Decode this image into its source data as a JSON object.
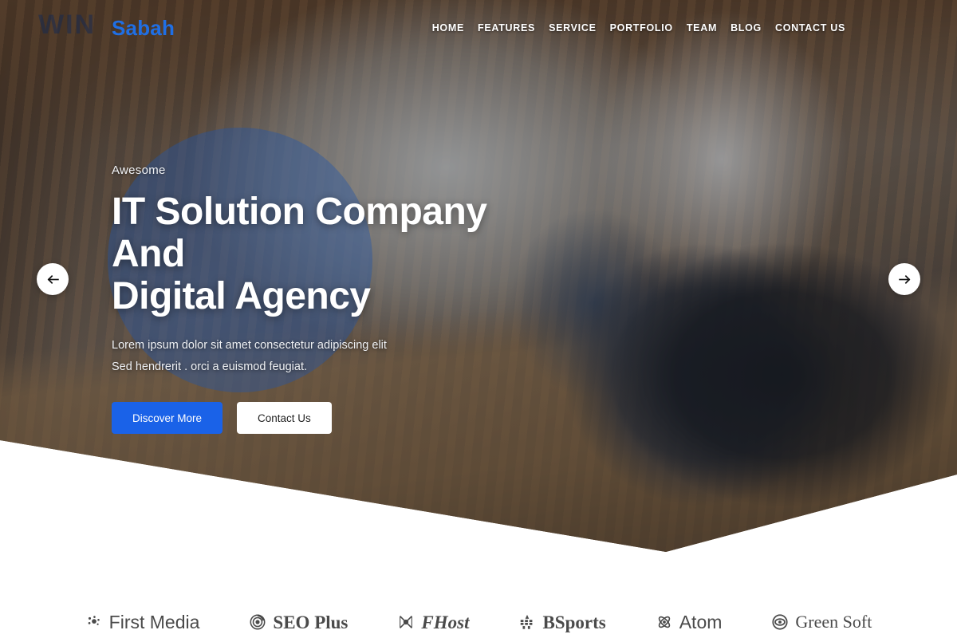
{
  "header": {
    "logo": "Sabah",
    "nav": [
      {
        "label": "HOME"
      },
      {
        "label": "FEATURES"
      },
      {
        "label": "SERVICE"
      },
      {
        "label": "PORTFOLIO"
      },
      {
        "label": "TEAM"
      },
      {
        "label": "BLOG"
      },
      {
        "label": "CONTACT US"
      }
    ]
  },
  "hero": {
    "background_sign_text": "WIN",
    "eyebrow": "Awesome",
    "title_line1": "IT Solution Company And",
    "title_line2": "Digital Agency",
    "description_line1": "Lorem ipsum dolor sit amet consectetur adipiscing elit",
    "description_line2": "Sed hendrerit . orci a euismod feugiat.",
    "primary_button": "Discover More",
    "secondary_button": "Contact Us",
    "prev_arrow_icon": "arrow-left-icon",
    "next_arrow_icon": "arrow-right-icon",
    "accent_color": "#1a62e8",
    "circle_overlay_color": "#2456a6"
  },
  "brands": [
    {
      "name": "First Media",
      "icon": "dots-cluster-icon"
    },
    {
      "name": "SEO Plus",
      "icon": "spiral-circle-icon"
    },
    {
      "name": "FHost",
      "icon": "bowtie-knot-icon"
    },
    {
      "name": "BSports",
      "icon": "grid-burst-icon"
    },
    {
      "name": "Atom",
      "icon": "atom-loop-icon"
    },
    {
      "name": "Green Soft",
      "icon": "eye-circle-icon"
    }
  ]
}
